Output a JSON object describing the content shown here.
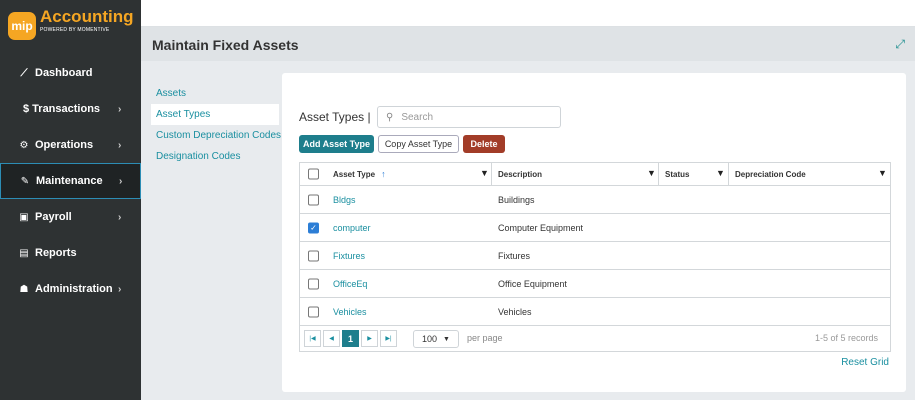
{
  "logo": {
    "badge": "mip",
    "title": "Accounting",
    "subtitle": "POWERED BY MOMENTIVE"
  },
  "sidebar": {
    "items": [
      {
        "label": "Dashboard",
        "icon": "chart-line-icon",
        "glyph": "⟋"
      },
      {
        "label": "$ Transactions",
        "icon": "",
        "glyph": ""
      },
      {
        "label": "Operations",
        "icon": "gears-icon",
        "glyph": "⚙"
      },
      {
        "label": "Maintenance",
        "icon": "wrench-icon",
        "glyph": "✎"
      },
      {
        "label": "Payroll",
        "icon": "money-icon",
        "glyph": "▣"
      },
      {
        "label": "Reports",
        "icon": "report-icon",
        "glyph": "▤"
      },
      {
        "label": "Administration",
        "icon": "users-icon",
        "glyph": "☗"
      }
    ],
    "arrow": "›"
  },
  "header": {
    "title": "Maintain Fixed Assets",
    "expand_glyph": "⤢"
  },
  "subnav": {
    "items": [
      {
        "label": "Assets"
      },
      {
        "label": "Asset Types"
      },
      {
        "label": "Custom Depreciation Codes"
      },
      {
        "label": "Designation Codes"
      }
    ]
  },
  "main": {
    "title": "Asset Types |",
    "search_placeholder": "Search",
    "buttons": {
      "add": "Add Asset Type",
      "copy": "Copy Asset Type",
      "delete": "Delete"
    }
  },
  "grid": {
    "columns": [
      "Asset Type",
      "Description",
      "Status",
      "Depreciation Code"
    ],
    "sort_glyph": "↑",
    "rows": [
      {
        "type": "Bldgs",
        "description": "Buildings",
        "status": "",
        "dep_code": "",
        "checked": false
      },
      {
        "type": "computer",
        "description": "Computer Equipment",
        "status": "",
        "dep_code": "",
        "checked": true
      },
      {
        "type": "Fixtures",
        "description": "Fixtures",
        "status": "",
        "dep_code": "",
        "checked": false
      },
      {
        "type": "OfficeEq",
        "description": "Office Equipment",
        "status": "",
        "dep_code": "",
        "checked": false
      },
      {
        "type": "Vehicles",
        "description": "Vehicles",
        "status": "",
        "dep_code": "",
        "checked": false
      }
    ]
  },
  "pager": {
    "current_page": "1",
    "page_size": "100",
    "per_page_label": "per page",
    "records": "1-5 of 5 records"
  },
  "reset_label": "Reset Grid",
  "colors": {
    "sidebar": "#2e3233",
    "accent": "#1e7e8c",
    "link": "#1a8fa0",
    "logo": "#f5a623",
    "delete": "#a23c28"
  }
}
